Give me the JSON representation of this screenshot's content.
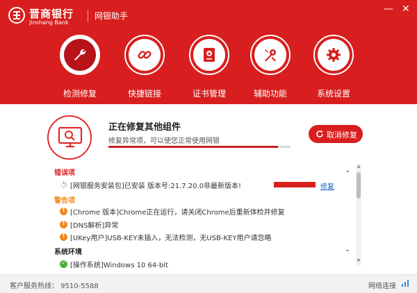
{
  "app": {
    "brand_cn": "晋商银行",
    "brand_en": "Jinshang Bank",
    "title": "网银助手",
    "minimize": "—",
    "close": "✕"
  },
  "nav": [
    {
      "label": "检测修复",
      "icon": "wrench-icon",
      "active": true
    },
    {
      "label": "快捷链接",
      "icon": "link-icon",
      "active": false
    },
    {
      "label": "证书管理",
      "icon": "certificate-icon",
      "active": false
    },
    {
      "label": "辅助功能",
      "icon": "tools-icon",
      "active": false
    },
    {
      "label": "系统设置",
      "icon": "gear-icon",
      "active": false
    }
  ],
  "status": {
    "title": "正在修复其他组件",
    "subtitle": "修复异常项，可以使您正常使用网银",
    "progress": 0.93,
    "cancel_label": "取消修复"
  },
  "sections": {
    "errors": {
      "title": "错误项",
      "items": [
        {
          "text": "[网银服务安装包]已安装 版本号:21.7.20.0非最新版本!",
          "action": "修复"
        }
      ]
    },
    "warnings": {
      "title": "警告项",
      "items": [
        {
          "text": "[Chrome 版本]Chrome正在运行，请关闭Chrome后重新体检并修复"
        },
        {
          "text": "[DNS解析]异常"
        },
        {
          "text": "[UKey用户]USB-KEY未插入，无法检测，无USB-KEY用户请忽略"
        }
      ]
    },
    "system": {
      "title": "系统环境",
      "items": [
        {
          "text": "[操作系统]Windows 10 64-bit"
        }
      ]
    }
  },
  "footer": {
    "hotline": "客户服务热线：  9510-5588",
    "network": "网络连接"
  },
  "colors": {
    "brand_red": "#d81e1e",
    "warning_orange": "#f08a1c",
    "ok_green": "#4caf3c",
    "link_blue": "#1b5bbf"
  }
}
